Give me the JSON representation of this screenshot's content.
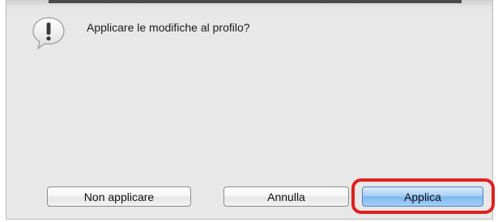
{
  "dialog": {
    "message": "Applicare le modifiche al profilo?",
    "icon": "alert-icon"
  },
  "buttons": {
    "dont_apply_label": "Non applicare",
    "cancel_label": "Annulla",
    "apply_label": "Applica"
  },
  "colors": {
    "dialog_background": "#e8e8e8",
    "default_button": "#7db8f1",
    "highlight": "#e0201f"
  }
}
